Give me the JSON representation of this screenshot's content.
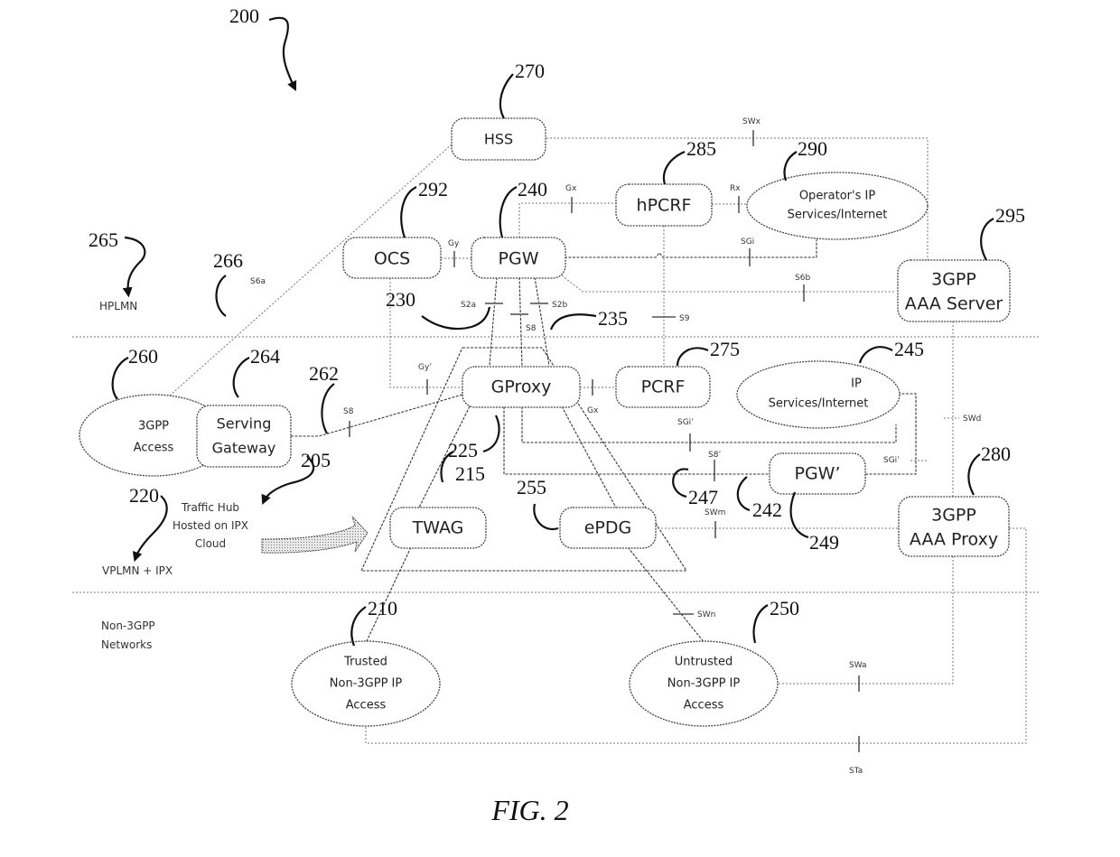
{
  "figure": {
    "caption": "FIG. 2",
    "main_ref": "200"
  },
  "regions": {
    "hplmn": {
      "label": "HPLMN",
      "ref": "265"
    },
    "vplmn": {
      "label": "VPLMN + IPX",
      "ref": "220"
    },
    "non3gpp": {
      "label_line1": "Non-3GPP",
      "label_line2": "Networks"
    }
  },
  "traffic_hub": {
    "ref": "205",
    "line1": "Traffic Hub",
    "line2": "Hosted on IPX",
    "line3": "Cloud"
  },
  "nodes": {
    "hss": {
      "label": "HSS",
      "ref": "270"
    },
    "hpcrf": {
      "label": "hPCRF",
      "ref": "285"
    },
    "operator_ip": {
      "line1": "Operator's IP",
      "line2": "Services/Internet",
      "ref": "290"
    },
    "ocs": {
      "label": "OCS",
      "ref": "292"
    },
    "pgw": {
      "label": "PGW",
      "ref": "240"
    },
    "aaa_server": {
      "line1": "3GPP",
      "line2": "AAA Server",
      "ref": "295"
    },
    "access_3gpp": {
      "line1": "3GPP",
      "line2": "Access",
      "ref": "260"
    },
    "serving_gw": {
      "line1": "Serving",
      "line2": "Gateway",
      "ref": "264"
    },
    "gproxy": {
      "label": "GProxy",
      "ref": "225"
    },
    "pcrf": {
      "label": "PCRF",
      "ref": "275"
    },
    "ip_services": {
      "line1": "IP",
      "line2": "Services/Internet",
      "ref": "245"
    },
    "pgw_prime": {
      "label": "PGW’",
      "ref": "249"
    },
    "twag": {
      "label": "TWAG",
      "ref": "215"
    },
    "epdg": {
      "label": "ePDG",
      "ref": "255"
    },
    "aaa_proxy": {
      "line1": "3GPP",
      "line2": "AAA Proxy",
      "ref": "280"
    },
    "trusted": {
      "line1": "Trusted",
      "line2": "Non-3GPP IP",
      "line3": "Access",
      "ref": "210"
    },
    "untrusted": {
      "line1": "Untrusted",
      "line2": "Non-3GPP IP",
      "line3": "Access",
      "ref": "250"
    }
  },
  "link_refs": {
    "s6a_ref": "266",
    "s8_ref": "262",
    "s2a_ref": "230",
    "s8_pgw_ref": "235",
    "sgi_prime_ref": "247",
    "s8_prime_ref": "242"
  },
  "interfaces": {
    "swx": "SWx",
    "gx_top": "Gx",
    "rx": "Rx",
    "gy": "Gy",
    "sgi": "SGi",
    "s6b": "S6b",
    "s6a": "S6a",
    "s2a": "S2a",
    "s2b": "S2b",
    "s8_pgw": "S8",
    "s9": "S9",
    "gy_prime": "Gy’",
    "s8": "S8",
    "gx_bottom": "Gx",
    "sgi_prime": "SGi’",
    "s8_prime": "S8’",
    "sgi_prime_right": "SGi’",
    "swd": "SWd",
    "swm": "SWm",
    "swn": "SWn",
    "swa": "SWa",
    "sta": "STa"
  }
}
